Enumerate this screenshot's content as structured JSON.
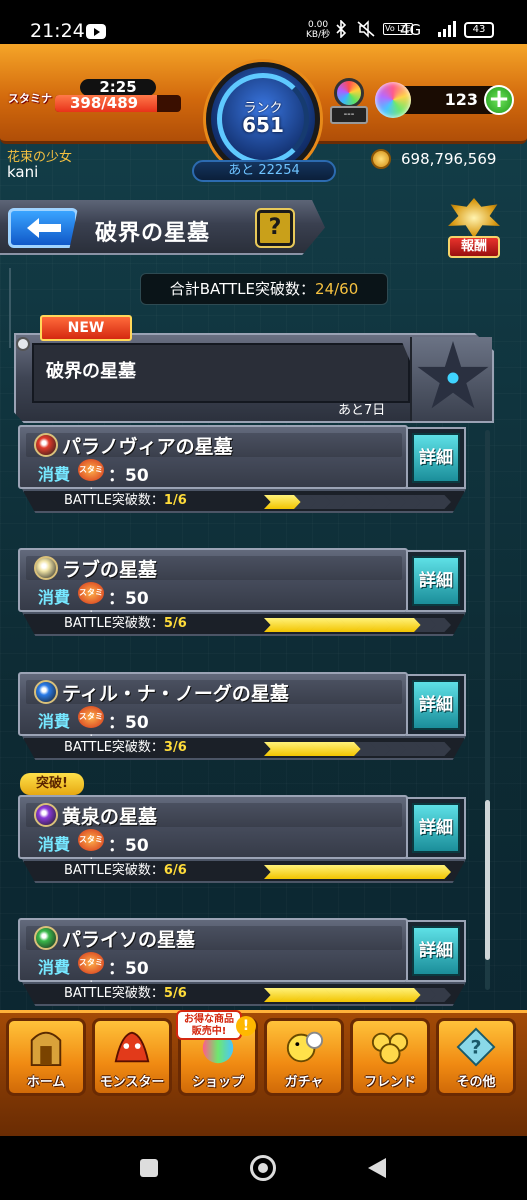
{
  "status_bar": {
    "time": "21:24",
    "speed": "0.00\nKB/秒",
    "volte": "Vo LTE",
    "network": "4G",
    "battery": "43",
    "icons": [
      "youtube-icon",
      "bluetooth-icon",
      "mute-icon",
      "signal-icon",
      "battery-icon"
    ]
  },
  "hud": {
    "stamina_label": "スタミナ",
    "stamina_timer": "2:25",
    "stamina_text": "398/489",
    "stamina_fill": 0.81,
    "rank_label": "ランク",
    "rank_value": "651",
    "rank_next": "あと 22254",
    "orb_dash": "---",
    "gem_count": "123",
    "gem_add": "+",
    "player_title": "花束の少女",
    "player_name": "kani",
    "coin_value": "698,796,569"
  },
  "header": {
    "title": "破界の星墓",
    "help": "?",
    "reward": "報酬"
  },
  "total": {
    "label": "合計BATTLE突破数：",
    "value": "24/60"
  },
  "event": {
    "badge": "NEW",
    "name": "破界の星墓",
    "remain": "あと7日"
  },
  "quests": [
    {
      "name": "パラノヴィアの星墓",
      "cost_label": "消費",
      "sta": "スタミナ",
      "cost": "：50",
      "prog_label": "BATTLE突破数：",
      "prog": "1/6",
      "done": 1,
      "total": 6,
      "elem_color": "#e03a2a",
      "detail": "詳細",
      "break": ""
    },
    {
      "name": "ラブの星墓",
      "cost_label": "消費",
      "sta": "スタミナ",
      "cost": "：50",
      "prog_label": "BATTLE突破数：",
      "prog": "5/6",
      "done": 5,
      "total": 6,
      "elem_color": "#f2e6a8",
      "detail": "詳細",
      "break": ""
    },
    {
      "name": "ティル・ナ・ノーグの星墓",
      "cost_label": "消費",
      "sta": "スタミナ",
      "cost": "：50",
      "prog_label": "BATTLE突破数：",
      "prog": "3/6",
      "done": 3,
      "total": 6,
      "elem_color": "#2a7be8",
      "detail": "詳細",
      "break": ""
    },
    {
      "name": "黄泉の星墓",
      "cost_label": "消費",
      "sta": "スタミナ",
      "cost": "：50",
      "prog_label": "BATTLE突破数：",
      "prog": "6/6",
      "done": 6,
      "total": 6,
      "elem_color": "#8a3ad8",
      "detail": "詳細",
      "break": "突破!"
    },
    {
      "name": "パライソの星墓",
      "cost_label": "消費",
      "sta": "スタミナ",
      "cost": "：50",
      "prog_label": "BATTLE突破数：",
      "prog": "5/6",
      "done": 5,
      "total": 6,
      "elem_color": "#3ab84a",
      "detail": "詳細",
      "break": ""
    }
  ],
  "nav": [
    {
      "label": "ホーム",
      "icon": "home-icon"
    },
    {
      "label": "モンスター",
      "icon": "monster-icon"
    },
    {
      "label": "ショップ",
      "icon": "shop-icon"
    },
    {
      "label": "ガチャ",
      "icon": "gacha-icon"
    },
    {
      "label": "フレンド",
      "icon": "friend-icon"
    },
    {
      "label": "その他",
      "icon": "other-icon"
    }
  ],
  "shop_badge": "お得な商品\n販売中!",
  "shop_bang": "!"
}
